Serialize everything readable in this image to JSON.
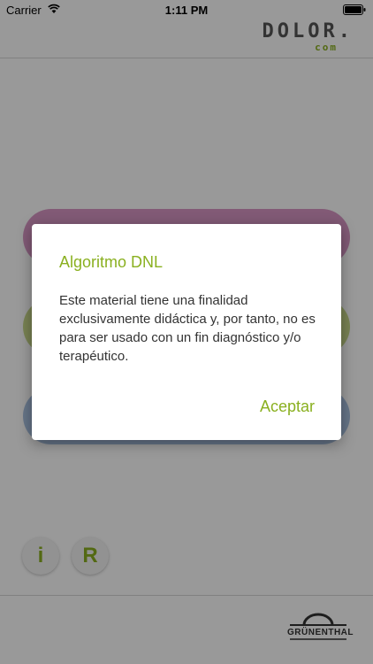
{
  "status_bar": {
    "carrier": "Carrier",
    "time": "1:11 PM"
  },
  "header": {
    "logo_main": "DOLOR.",
    "logo_sub": "com"
  },
  "round_buttons": {
    "info": "i",
    "r": "R"
  },
  "footer": {
    "logo_text": "GRÜNENTHAL"
  },
  "dialog": {
    "title": "Algoritmo DNL",
    "message": "Este material tiene una finalidad exclusivamente didáctica y, por tanto, no es para ser usado con un fin diagnóstico y/o terapéutico.",
    "accept_label": "Aceptar"
  },
  "colors": {
    "accent": "#8ab020",
    "pill_pink": "#d997c5",
    "pill_green": "#c9d98a",
    "pill_blue": "#a9c2e2"
  }
}
